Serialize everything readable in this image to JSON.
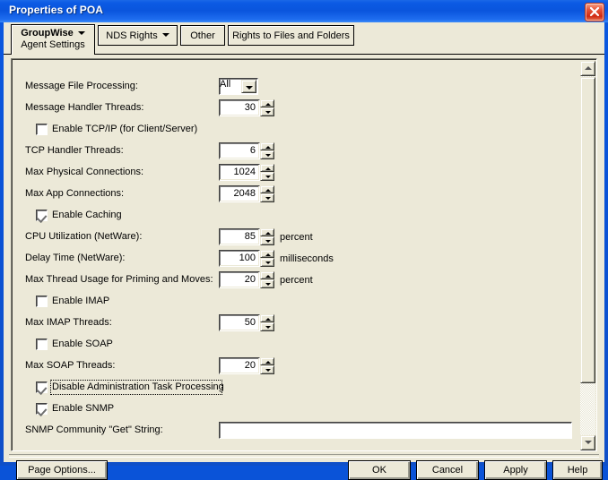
{
  "window": {
    "title": "Properties of POA",
    "close_icon": "close-icon"
  },
  "tabs": [
    {
      "label": "GroupWise",
      "sublabel": "Agent Settings",
      "selected": true,
      "has_caret": true
    },
    {
      "label": "NDS Rights",
      "selected": false,
      "has_caret": true
    },
    {
      "label": "Other",
      "selected": false,
      "has_caret": false
    },
    {
      "label": "Rights to Files and Folders",
      "selected": false,
      "has_caret": false
    }
  ],
  "form": {
    "rows": [
      {
        "kind": "combo",
        "label": "Message File Processing:",
        "value": "All",
        "unit": ""
      },
      {
        "kind": "spinner",
        "label": "Message Handler Threads:",
        "value": "30",
        "unit": ""
      },
      {
        "kind": "checkbox",
        "label": "Enable TCP/IP (for Client/Server)",
        "checked": false,
        "focused": false
      },
      {
        "kind": "spinner",
        "label": "TCP Handler Threads:",
        "value": "6",
        "unit": ""
      },
      {
        "kind": "spinner",
        "label": "Max Physical Connections:",
        "value": "1024",
        "unit": ""
      },
      {
        "kind": "spinner",
        "label": "Max App Connections:",
        "value": "2048",
        "unit": ""
      },
      {
        "kind": "checkbox",
        "label": "Enable Caching",
        "checked": true,
        "focused": false
      },
      {
        "kind": "spinner",
        "label": "CPU Utilization (NetWare):",
        "value": "85",
        "unit": "percent"
      },
      {
        "kind": "spinner",
        "label": "Delay Time (NetWare):",
        "value": "100",
        "unit": "milliseconds"
      },
      {
        "kind": "spinner",
        "label": "Max Thread Usage for Priming and Moves:",
        "value": "20",
        "unit": "percent"
      },
      {
        "kind": "checkbox",
        "label": "Enable IMAP",
        "checked": false,
        "focused": false
      },
      {
        "kind": "spinner",
        "label": "Max IMAP Threads:",
        "value": "50",
        "unit": ""
      },
      {
        "kind": "checkbox",
        "label": "Enable SOAP",
        "checked": false,
        "focused": false
      },
      {
        "kind": "spinner",
        "label": "Max SOAP Threads:",
        "value": "20",
        "unit": ""
      },
      {
        "kind": "checkbox",
        "label": "Disable Administration Task Processing",
        "checked": true,
        "focused": true
      },
      {
        "kind": "checkbox",
        "label": "Enable SNMP",
        "checked": true,
        "focused": false
      },
      {
        "kind": "textfield",
        "label": "SNMP Community \"Get\" String:",
        "value": "",
        "unit": ""
      }
    ]
  },
  "scrollbar": {
    "up_icon": "scroll-up-icon",
    "down_icon": "scroll-down-icon"
  },
  "footer": {
    "page_options": "Page Options...",
    "ok": "OK",
    "cancel": "Cancel",
    "apply": "Apply",
    "help": "Help"
  },
  "colors": {
    "titlebar": "#0a55dd",
    "face": "#ece9d8",
    "close": "#cf2a13"
  }
}
